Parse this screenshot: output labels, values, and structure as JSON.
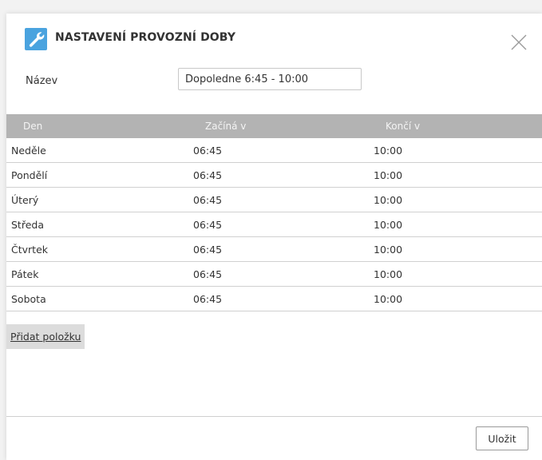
{
  "dialog": {
    "title": "NASTAVENÍ PROVOZNÍ DOBY",
    "icon": "wrench-icon",
    "accent_color": "#4aa3df"
  },
  "form": {
    "name_label": "Název",
    "name_value": "Dopoledne 6:45 - 10:00"
  },
  "table": {
    "columns": [
      "Den",
      "Začíná v",
      "Končí v"
    ],
    "rows": [
      {
        "day": "Neděle",
        "start": "06:45",
        "end": "10:00"
      },
      {
        "day": "Pondělí",
        "start": "06:45",
        "end": "10:00"
      },
      {
        "day": "Úterý",
        "start": "06:45",
        "end": "10:00"
      },
      {
        "day": "Středa",
        "start": "06:45",
        "end": "10:00"
      },
      {
        "day": "Čtvrtek",
        "start": "06:45",
        "end": "10:00"
      },
      {
        "day": "Pátek",
        "start": "06:45",
        "end": "10:00"
      },
      {
        "day": "Sobota",
        "start": "06:45",
        "end": "10:00"
      }
    ],
    "header_color": "#b3b3b3"
  },
  "actions": {
    "add_item_label": "Přidat položku",
    "save_label": "Uložit"
  }
}
